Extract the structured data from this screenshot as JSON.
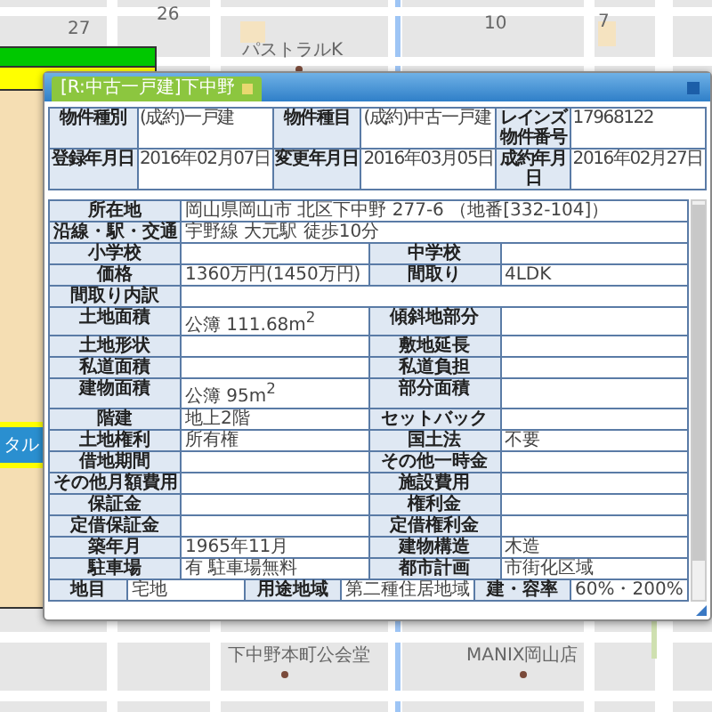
{
  "map": {
    "labels": [
      {
        "text": "27",
        "kind": "number"
      },
      {
        "text": "26",
        "kind": "number"
      },
      {
        "text": "パストラルK",
        "kind": "place"
      },
      {
        "text": "10",
        "kind": "number"
      },
      {
        "text": "7",
        "kind": "number"
      },
      {
        "text": "下中野本町公会堂",
        "kind": "place"
      },
      {
        "text": "MANIX岡山店",
        "kind": "place"
      }
    ]
  },
  "side_panel": {
    "button": "タル"
  },
  "dialog": {
    "tab": {
      "label": "[R:中古一戸建]下中野",
      "selected": true
    },
    "summary": [
      [
        {
          "label": "物件種別",
          "value": "(成約)一戸建"
        },
        {
          "label": "物件種目",
          "value": "(成約)中古一戸建"
        },
        {
          "label": "レインズ物件番号",
          "value": "17968122"
        }
      ],
      [
        {
          "label": "登録年月日",
          "value": "2016年02月07日"
        },
        {
          "label": "変更年月日",
          "value": "2016年03月05日"
        },
        {
          "label": "成約年月日",
          "value": "2016年02月27日"
        }
      ]
    ],
    "details": [
      [
        {
          "label": "所在地",
          "value": "岡山県岡山市 北区下中野 277-6 （地番[332-104]）"
        }
      ],
      [
        {
          "label": "沿線・駅・交通",
          "value": "宇野線 大元駅 徒歩10分"
        }
      ],
      [
        {
          "label": "小学校"
        },
        {
          "label": "中学校"
        }
      ],
      [
        {
          "label": "価格",
          "value": "1360万円(1450万円)"
        },
        {
          "label": "間取り",
          "value": "4LDK"
        }
      ],
      [
        {
          "label": "間取り内訳"
        }
      ],
      [
        {
          "label": "土地面積",
          "value": "公簿 111.68m$^{2}$"
        },
        {
          "label": "傾斜地部分"
        }
      ],
      [
        {
          "label": "土地形状"
        },
        {
          "label": "敷地延長"
        }
      ],
      [
        {
          "label": "私道面積"
        },
        {
          "label": "私道負担"
        }
      ],
      [
        {
          "label": "建物面積",
          "value": "公簿 95m$^{2}$"
        },
        {
          "label": "部分面積"
        }
      ],
      [
        {
          "label": "階建",
          "value": "地上2階"
        },
        {
          "label": "セットバック"
        }
      ],
      [
        {
          "label": "土地権利",
          "value": "所有権"
        },
        {
          "label": "国土法",
          "value": "不要"
        }
      ],
      [
        {
          "label": "借地期間"
        },
        {
          "label": "その他一時金"
        }
      ],
      [
        {
          "label": "その他月額費用"
        },
        {
          "label": "施設費用"
        }
      ],
      [
        {
          "label": "保証金"
        },
        {
          "label": "権利金"
        }
      ],
      [
        {
          "label": "定借保証金"
        },
        {
          "label": "定借権利金"
        }
      ],
      [
        {
          "label": "築年月",
          "value": "1965年11月"
        },
        {
          "label": "建物構造",
          "value": "木造"
        }
      ],
      [
        {
          "label": "駐車場",
          "value": "有 駐車場無料"
        },
        {
          "label": "都市計画",
          "value": "市街化区域"
        }
      ],
      [
        {
          "label": "地目",
          "value": "宅地"
        },
        {
          "label": "用途地域",
          "value": "第二種住居地域"
        },
        {
          "label": "建・容率",
          "value": "60%・200%"
        }
      ]
    ]
  }
}
